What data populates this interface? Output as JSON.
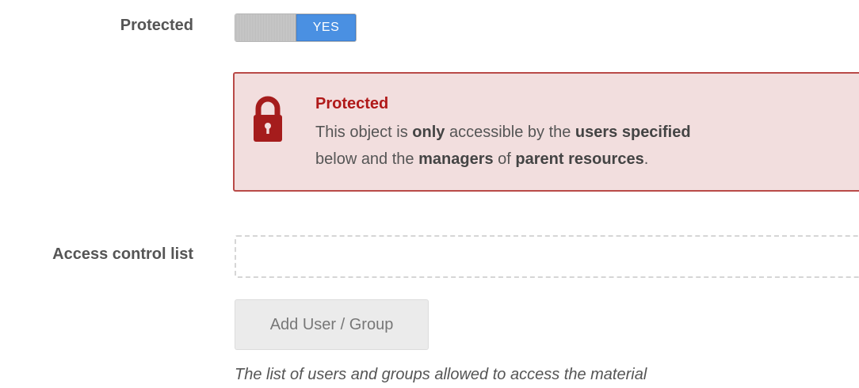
{
  "protected_field": {
    "label": "Protected",
    "toggle_value": "YES",
    "toggle_on": true
  },
  "alert": {
    "icon": "lock-icon",
    "title": "Protected",
    "body_parts": [
      "This object is ",
      "only",
      " accessible by the ",
      "users specified",
      " below and the ",
      "managers",
      " of ",
      "parent resources",
      "."
    ],
    "colors": {
      "background": "#f2dede",
      "border": "#b94a48",
      "title": "#b01919",
      "icon": "#a51c1c"
    }
  },
  "acl_field": {
    "label": "Access control list",
    "add_button_label": "Add User / Group",
    "help_text": "The list of users and groups allowed to access the material"
  },
  "accent_color": "#4a90e2"
}
